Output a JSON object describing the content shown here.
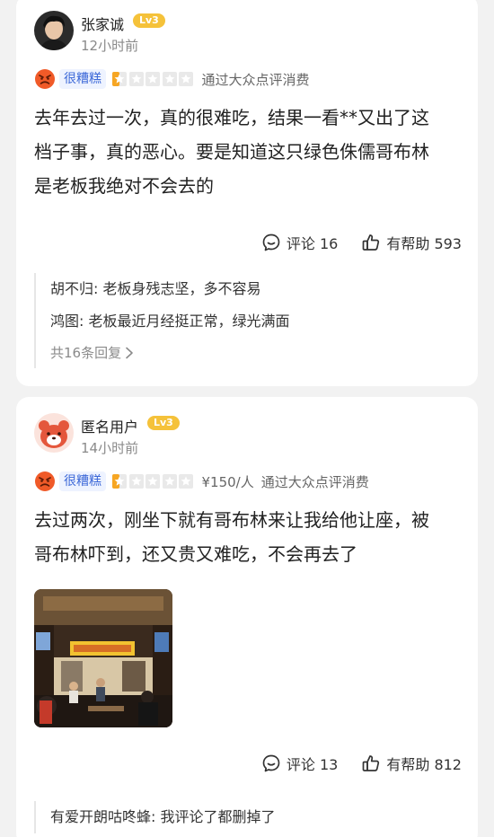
{
  "reviews": [
    {
      "username": "张家诚",
      "level": "Lv3",
      "time": "12小时前",
      "rating_word": "很糟糕",
      "rating": 1,
      "price": "",
      "via": "通过大众点评消费",
      "content_lines": [
        "去年去过一次，真的很难吃，结果一看**又出了这",
        "档子事，真的恶心。要是知道这只绿色侏儒哥布林",
        "是老板我绝对不会去的"
      ],
      "comments_label": "评论 16",
      "helpful_label": "有帮助 593",
      "replies": [
        "胡不归: 老板身残志坚，多不容易",
        "鸿图: 老板最近月经挺正常，绿光满面"
      ],
      "more_replies": "共16条回复"
    },
    {
      "username": "匿名用户",
      "level": "Lv3",
      "time": "14小时前",
      "rating_word": "很糟糕",
      "rating": 1,
      "price": "¥150/人",
      "via": "通过大众点评消费",
      "content_lines": [
        "去过两次，刚坐下就有哥布林来让我给他让座，被",
        "哥布林吓到，还又贵又难吃，不会再去了"
      ],
      "comments_label": "评论 13",
      "helpful_label": "有帮助 812",
      "replies": [
        "有爱开朗咕咚蜂: 我评论了都删掉了"
      ]
    }
  ],
  "colors": {
    "accent_blue": "#3d69d8",
    "star_orange": "#f6a623",
    "level_badge": "#f5c23a",
    "mood_red": "#f05a28"
  },
  "icons": {
    "comment": "comment-bubble-icon",
    "helpful": "thumbs-up-icon",
    "mood": "angry-face-icon"
  }
}
